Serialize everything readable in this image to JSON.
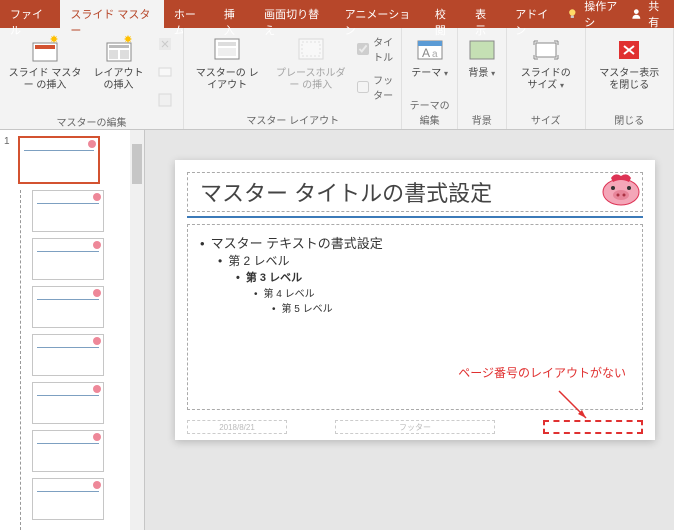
{
  "tabs": {
    "file": "ファイル",
    "slidemaster": "スライド マスター",
    "home": "ホーム",
    "insert": "挿入",
    "transition": "画面切り替え",
    "animation": "アニメーション",
    "review": "校閲",
    "view": "表示",
    "addin": "アドイン"
  },
  "titlebar": {
    "tellme": "操作アシ",
    "share": "共有"
  },
  "ribbon": {
    "groups": {
      "edit_master": {
        "label": "マスターの編集",
        "insert_slide_master": "スライド マスター\nの挿入",
        "insert_layout": "レイアウト\nの挿入"
      },
      "master_layout": {
        "label": "マスター レイアウト",
        "master_layout_btn": "マスターの\nレイアウト",
        "insert_placeholder": "プレースホルダー\nの挿入",
        "chk_title": "タイトル",
        "chk_footer": "フッター"
      },
      "edit_theme": {
        "label": "テーマの編集",
        "theme": "テーマ"
      },
      "background": {
        "label": "背景",
        "background_btn": "背景"
      },
      "size": {
        "label": "サイズ",
        "slide_size": "スライドの\nサイズ"
      },
      "close": {
        "label": "閉じる",
        "close_master": "マスター表示\nを閉じる"
      }
    }
  },
  "thumbpane": {
    "master_num": "1"
  },
  "slide": {
    "title": "マスター タイトルの書式設定",
    "body_lv1": "マスター テキストの書式設定",
    "body_lv2": "第 2 レベル",
    "body_lv3": "第 3 レベル",
    "body_lv4": "第 4 レベル",
    "body_lv5": "第 5 レベル",
    "date": "2018/8/21",
    "footer": "フッター"
  },
  "annotation": "ページ番号のレイアウトがない"
}
